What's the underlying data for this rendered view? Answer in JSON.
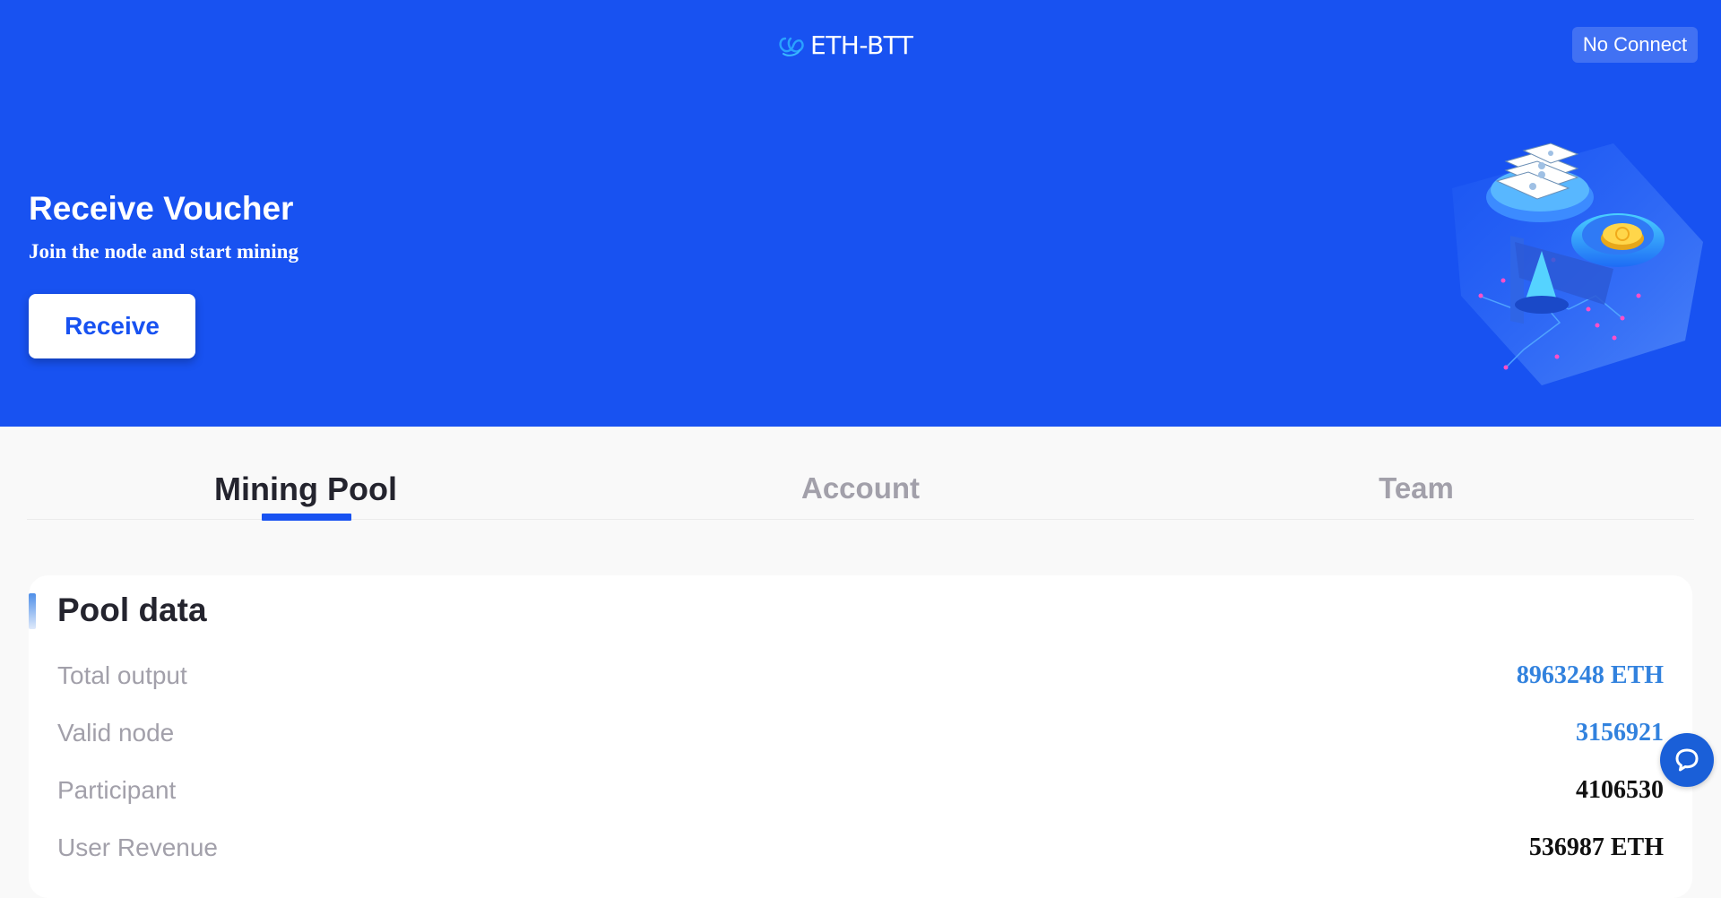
{
  "header": {
    "logo_text": "ETH-BTT",
    "connect_label": "No Connect"
  },
  "hero": {
    "title": "Receive Voucher",
    "subtitle": "Join the node and start mining",
    "receive_label": "Receive"
  },
  "tabs": [
    {
      "label": "Mining Pool",
      "active": true
    },
    {
      "label": "Account",
      "active": false
    },
    {
      "label": "Team",
      "active": false
    }
  ],
  "pool": {
    "title": "Pool data",
    "rows": [
      {
        "label": "Total output",
        "value": "8963248 ETH"
      },
      {
        "label": "Valid node",
        "value": "3156921"
      },
      {
        "label": "Participant",
        "value": "4106530"
      },
      {
        "label": "User Revenue",
        "value": "536987 ETH"
      }
    ]
  },
  "colors": {
    "brand": "#1852f1",
    "value_blue": "#3282de",
    "chat": "#1a5fd8"
  },
  "icons": {
    "logo": "infinity-logo-icon",
    "chat": "chat-bubble-icon"
  }
}
